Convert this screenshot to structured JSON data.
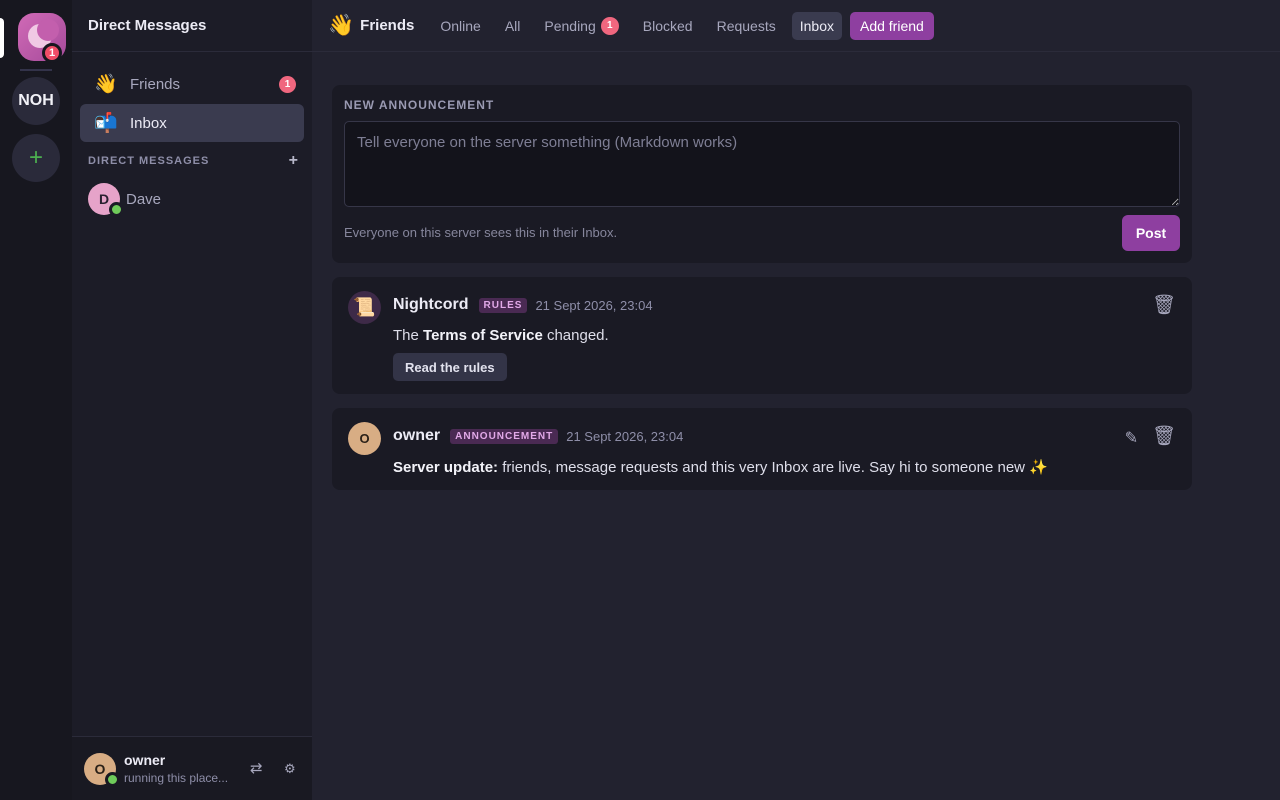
{
  "rail": {
    "home_badge": "1",
    "server_initials": "NOH",
    "add_server_icon": "+"
  },
  "sidebar": {
    "title": "Direct Messages",
    "items": [
      {
        "emoji": "👋",
        "label": "Friends",
        "badge": "1"
      },
      {
        "emoji": "📬",
        "label": "Inbox"
      }
    ],
    "section_title": "DIRECT MESSAGES",
    "section_add": "+",
    "dms": [
      {
        "initial": "D",
        "name": "Dave"
      }
    ]
  },
  "user_panel": {
    "initial": "O",
    "name": "owner",
    "status": "running this place..."
  },
  "topbar": {
    "emoji": "👋",
    "title": "Friends",
    "tabs": [
      {
        "label": "Online"
      },
      {
        "label": "All"
      },
      {
        "label": "Pending",
        "badge": "1"
      },
      {
        "label": "Blocked"
      },
      {
        "label": "Requests"
      },
      {
        "label": "Inbox"
      }
    ],
    "add_friend": "Add friend"
  },
  "composer": {
    "label": "NEW ANNOUNCEMENT",
    "placeholder": "Tell everyone on the server something (Markdown works)",
    "hint": "Everyone on this server sees this in their Inbox.",
    "post_label": "Post"
  },
  "posts": [
    {
      "avatar": "📜",
      "author": "Nightcord",
      "tag": "RULES",
      "time": "21 Sept 2026, 23:04",
      "body_pre": "The ",
      "body_bold": "Terms of Service",
      "body_post": " changed.",
      "action": "Read the rules"
    },
    {
      "avatar": "O",
      "author": "owner",
      "tag": "ANNOUNCEMENT",
      "time": "21 Sept 2026, 23:04",
      "body_bold": "Server update:",
      "body_post": " friends, message requests and this very Inbox are live. Say hi to someone new ✨"
    }
  ],
  "icons": {
    "trash": "🗑",
    "edit": "✎",
    "swap": "⇄",
    "settings": "⚙"
  },
  "colors": {
    "accent": "#8e3fa0",
    "badge": "#f0677f",
    "online": "#6fcb5a"
  }
}
